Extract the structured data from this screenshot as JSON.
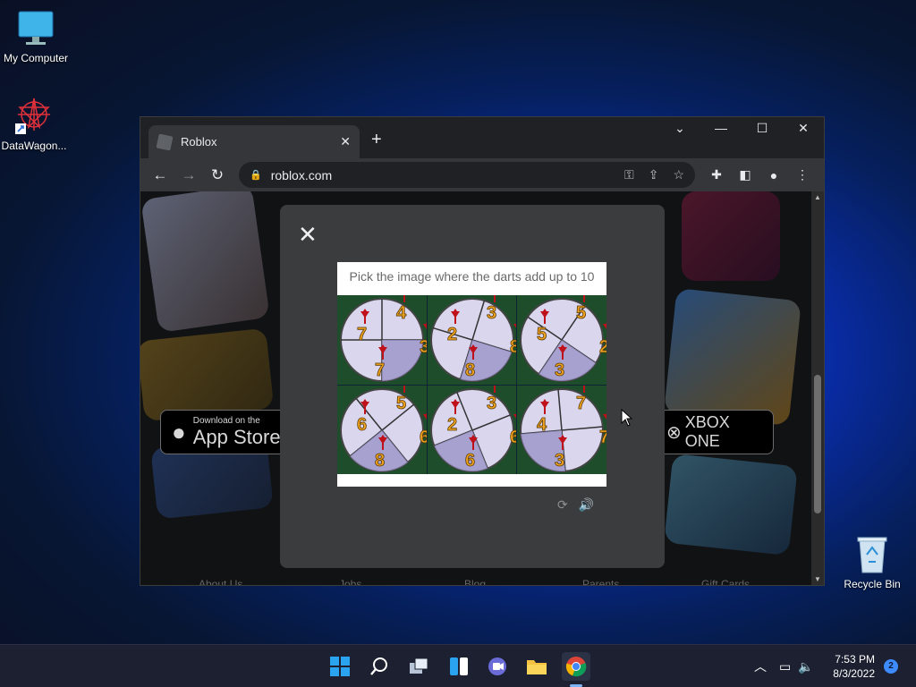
{
  "desktop": {
    "icons": [
      {
        "label": "My Computer"
      },
      {
        "label": "DataWagon..."
      },
      {
        "label": "Recycle Bin"
      }
    ]
  },
  "browser": {
    "tab_title": "Roblox",
    "url": "roblox.com",
    "page": {
      "app_store_small": "Download on the",
      "app_store_big": "App Store",
      "xbox_label": "XBOX ONE",
      "footer_links": [
        "About Us",
        "Jobs",
        "Blog",
        "Parents",
        "Gift Cards"
      ]
    }
  },
  "captcha": {
    "prompt": "Pick the image where the darts add up to 10",
    "tiles": [
      {
        "numbers": [
          "7",
          "4",
          "3",
          "7"
        ]
      },
      {
        "numbers": [
          "2",
          "3",
          "8",
          "8"
        ]
      },
      {
        "numbers": [
          "5",
          "5",
          "2",
          "3"
        ]
      },
      {
        "numbers": [
          "6",
          "5",
          "6",
          "8"
        ]
      },
      {
        "numbers": [
          "2",
          "3",
          "6",
          "6"
        ]
      },
      {
        "numbers": [
          "4",
          "7",
          "7",
          "3"
        ]
      }
    ]
  },
  "taskbar": {
    "time": "7:53 PM",
    "date": "8/3/2022",
    "notification_count": "2"
  },
  "colors": {
    "taskbar_bg": "#1c2030",
    "chrome_dark": "#202124",
    "chrome_toolbar": "#35363a",
    "modal_bg": "#3b3c3e",
    "dart_red": "#c0101a",
    "number_orange": "#f2a420"
  }
}
